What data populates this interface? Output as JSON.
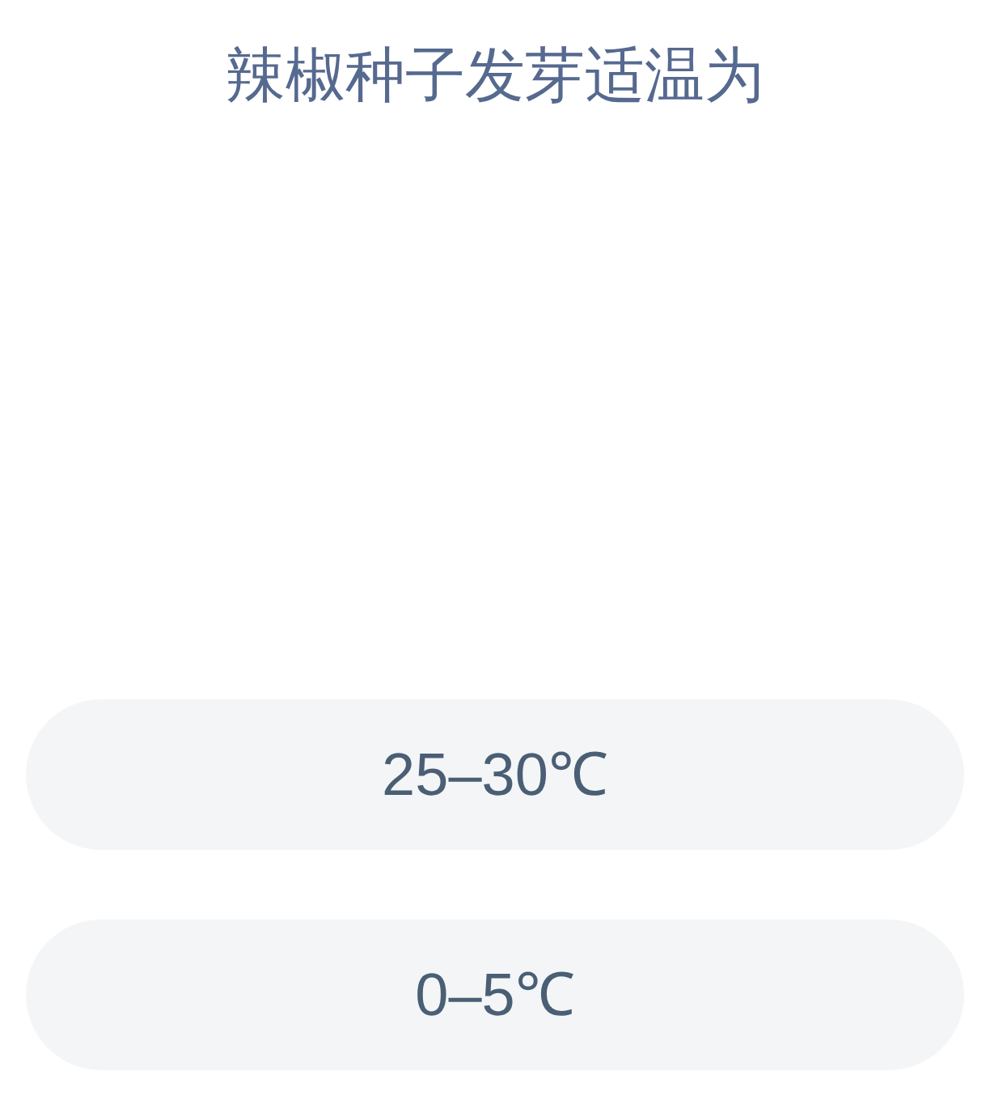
{
  "question": "辣椒种子发芽适温为",
  "options": [
    {
      "label": "25–30℃"
    },
    {
      "label": "0–5℃"
    }
  ]
}
